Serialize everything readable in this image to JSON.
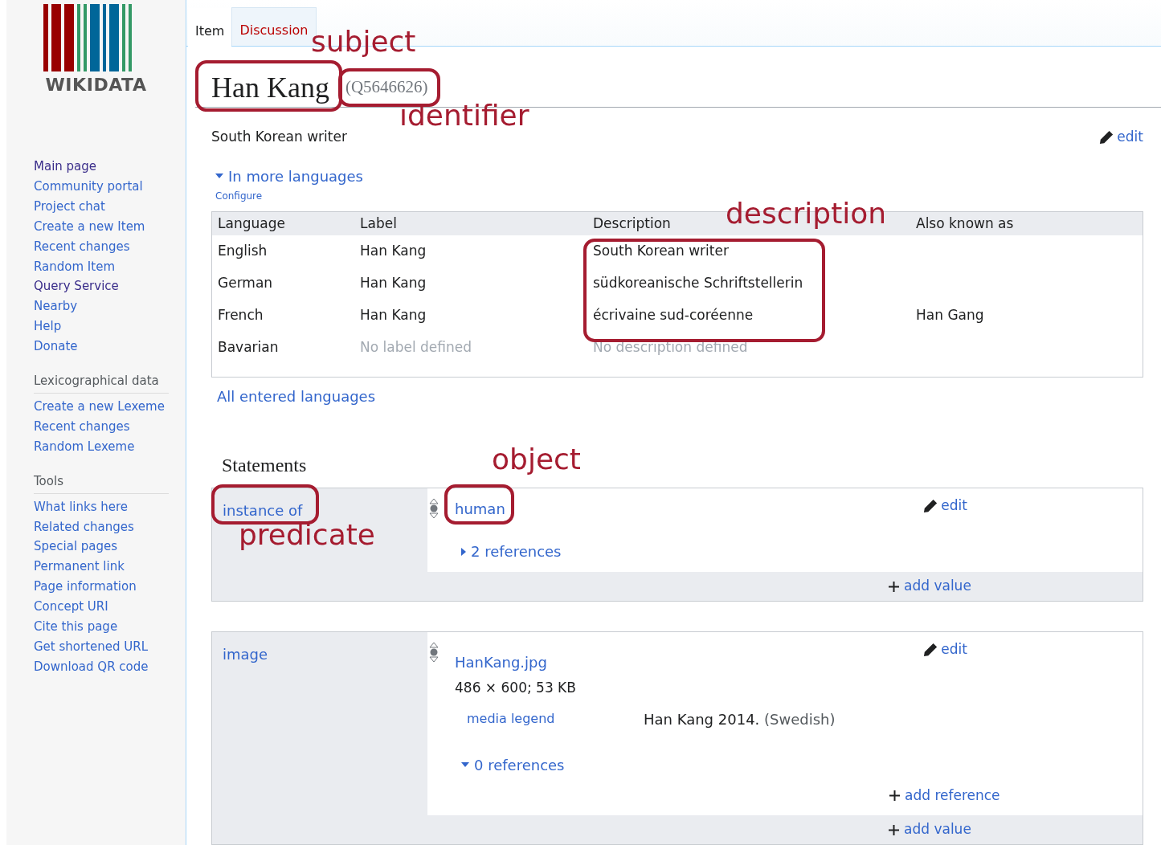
{
  "logo": {
    "wordmark": "WIKIDATA"
  },
  "sidebar": {
    "nav": [
      {
        "label": "Main page",
        "visited": true
      },
      {
        "label": "Community portal",
        "visited": false
      },
      {
        "label": "Project chat",
        "visited": false
      },
      {
        "label": "Create a new Item",
        "visited": false
      },
      {
        "label": "Recent changes",
        "visited": false
      },
      {
        "label": "Random Item",
        "visited": false
      },
      {
        "label": "Query Service",
        "visited": true
      },
      {
        "label": "Nearby",
        "visited": false
      },
      {
        "label": "Help",
        "visited": false
      },
      {
        "label": "Donate",
        "visited": false
      }
    ],
    "sections": [
      {
        "heading": "Lexicographical data",
        "items": [
          "Create a new Lexeme",
          "Recent changes",
          "Random Lexeme"
        ]
      },
      {
        "heading": "Tools",
        "items": [
          "What links here",
          "Related changes",
          "Special pages",
          "Permanent link",
          "Page information",
          "Concept URI",
          "Cite this page",
          "Get shortened URL",
          "Download QR code"
        ]
      }
    ]
  },
  "tabs": [
    {
      "label": "Item",
      "selected": true
    },
    {
      "label": "Discussion",
      "selected": false
    }
  ],
  "title": {
    "label": "Han Kang",
    "id": "(Q5646626)"
  },
  "description": "South Korean writer",
  "edit": "edit",
  "languages": {
    "toggle": "In more languages",
    "expanded": true,
    "configure": "Configure",
    "columns": [
      "Language",
      "Label",
      "Description",
      "Also known as"
    ],
    "rows": [
      {
        "language": "English",
        "label": "Han Kang",
        "label_missing": false,
        "description": "South Korean writer",
        "description_missing": false
      },
      {
        "language": "German",
        "label": "Han Kang",
        "label_missing": false,
        "description": "südkoreanische Schriftstellerin",
        "description_missing": false
      },
      {
        "language": "French",
        "label": "Han Kang",
        "label_missing": false,
        "description": "écrivaine sud-coréenne",
        "description_missing": false,
        "aliases": "Han Gang"
      },
      {
        "language": "Bavarian",
        "label": "No label defined",
        "label_missing": true,
        "description": "No description defined",
        "description_missing": true
      }
    ],
    "all_link": "All entered languages"
  },
  "statements": {
    "heading": "Statements",
    "groups": [
      {
        "property": "instance of",
        "values": [
          {
            "value": "human",
            "references": "2 references",
            "references_expanded": false,
            "edit": "edit"
          }
        ],
        "add_value": "add value"
      },
      {
        "property": "image",
        "values": [
          {
            "value": "HanKang.jpg",
            "file_info": "486 × 600; 53 KB",
            "qualifiers": [
              {
                "property": "media legend",
                "value": "Han Kang 2014.",
                "language": "(Swedish)"
              }
            ],
            "references": "0 references",
            "references_expanded": true,
            "add_reference": "add reference",
            "edit": "edit"
          }
        ],
        "add_value": "add value"
      }
    ]
  },
  "annotations": [
    {
      "label": "subject"
    },
    {
      "label": "identifier"
    },
    {
      "label": "description"
    },
    {
      "label": "object"
    },
    {
      "label": "predicate"
    }
  ]
}
